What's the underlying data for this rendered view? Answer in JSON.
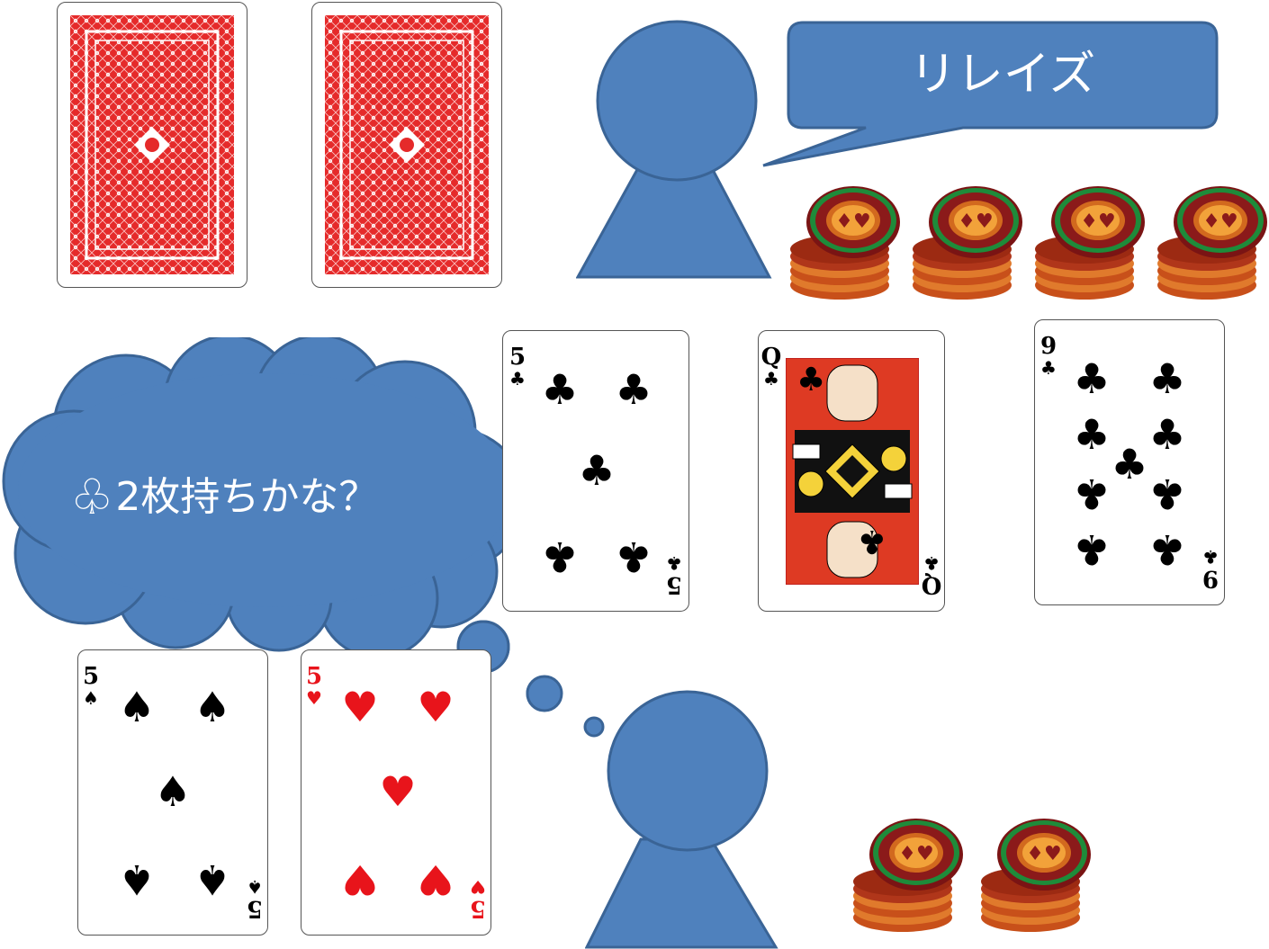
{
  "opponent": {
    "speech": "リレイズ",
    "chip_stacks": 4
  },
  "player": {
    "thought": "2枚持ちかな？",
    "thought_icon": "club-outline-icon",
    "chip_stacks": 2,
    "hand": [
      {
        "rank": "5",
        "suit": "♠",
        "color": "black"
      },
      {
        "rank": "5",
        "suit": "♥",
        "color": "red"
      }
    ]
  },
  "board": [
    {
      "rank": "5",
      "suit": "♣"
    },
    {
      "rank": "Q",
      "suit": "♣"
    },
    {
      "rank": "9",
      "suit": "♣"
    }
  ],
  "colors": {
    "figure": "#4f81bd",
    "figure_stroke": "#3a6496",
    "card_back": "#e52a2a",
    "chip_red": "#8b1a1a",
    "chip_orange": "#d2691e",
    "chip_green": "#1e8b3a"
  }
}
